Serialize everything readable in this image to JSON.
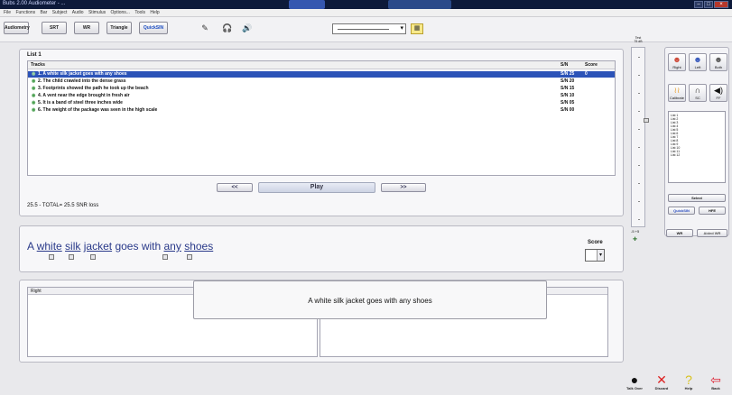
{
  "window": {
    "title": "Bubs 2.00 Audiometer - ...",
    "controls": [
      "–",
      "□",
      "×"
    ]
  },
  "menu": [
    "File",
    "Functions",
    "Bar",
    "Subject",
    "Audio",
    "Stimulus",
    "Options...",
    "Tools",
    "Help"
  ],
  "toolbar": {
    "modes": [
      "Audiometry",
      "SRT",
      "WR",
      "Triangle",
      "QuickSIN"
    ],
    "active_mode": "QuickSIN",
    "icons": [
      "edit-icon",
      "headphones-icon",
      "speaker-icon"
    ],
    "dropdown_value": "",
    "extra_icon": "chart-icon"
  },
  "list": {
    "title": "List 1",
    "columns": {
      "tracks": "Tracks",
      "sn": "S/N",
      "score": "Score"
    },
    "rows": [
      {
        "text": "1. A white silk jacket goes with any shoes",
        "sn": "S/N 25",
        "score": "0",
        "selected": true
      },
      {
        "text": "2. The child crawled into the dense grass",
        "sn": "S/N 20",
        "score": ""
      },
      {
        "text": "3. Footprints showed the path he took up the beach",
        "sn": "S/N 15",
        "score": ""
      },
      {
        "text": "4. A vent near the edge brought in fresh air",
        "sn": "S/N 10",
        "score": ""
      },
      {
        "text": "5. It is a band of steel three inches wide",
        "sn": "S/N 05",
        "score": ""
      },
      {
        "text": "6. The weight of the package was seen in the high scale",
        "sn": "S/N 00",
        "score": ""
      }
    ],
    "prev_label": "<<",
    "play_label": "Play",
    "next_label": ">>",
    "total": "25.5 - TOTAL= 25.5 SNR loss"
  },
  "level_slider": {
    "top_label": "Test\n75 dB",
    "bottom_label": "-5 +5"
  },
  "side": {
    "ear_buttons": [
      "Right",
      "Left",
      "Both"
    ],
    "option_buttons": [
      "Calibrate",
      "SC",
      "FF"
    ],
    "lists": [
      "List 1",
      "List 2",
      "List 3",
      "List 4",
      "List 5",
      "List 6",
      "List 7",
      "List 8",
      "List 9",
      "List 10",
      "List 11",
      "List 12"
    ],
    "select_label": "Select",
    "sub_buttons": [
      "QuickSIN",
      "HFE"
    ],
    "bottom_buttons": [
      "WR",
      "Aided WR"
    ]
  },
  "sentence": {
    "words": [
      "A",
      "white",
      "silk",
      "jacket",
      "goes",
      "with",
      "any",
      "shoes"
    ],
    "key_words": [
      1,
      2,
      3,
      6,
      7
    ],
    "score_label": "Score",
    "score_value": ""
  },
  "results": {
    "panel_title": "Right",
    "popup_text": "A white silk jacket goes with any shoes"
  },
  "bottom_bar": [
    "Talk Over",
    "Discard",
    "Help",
    "Back"
  ]
}
